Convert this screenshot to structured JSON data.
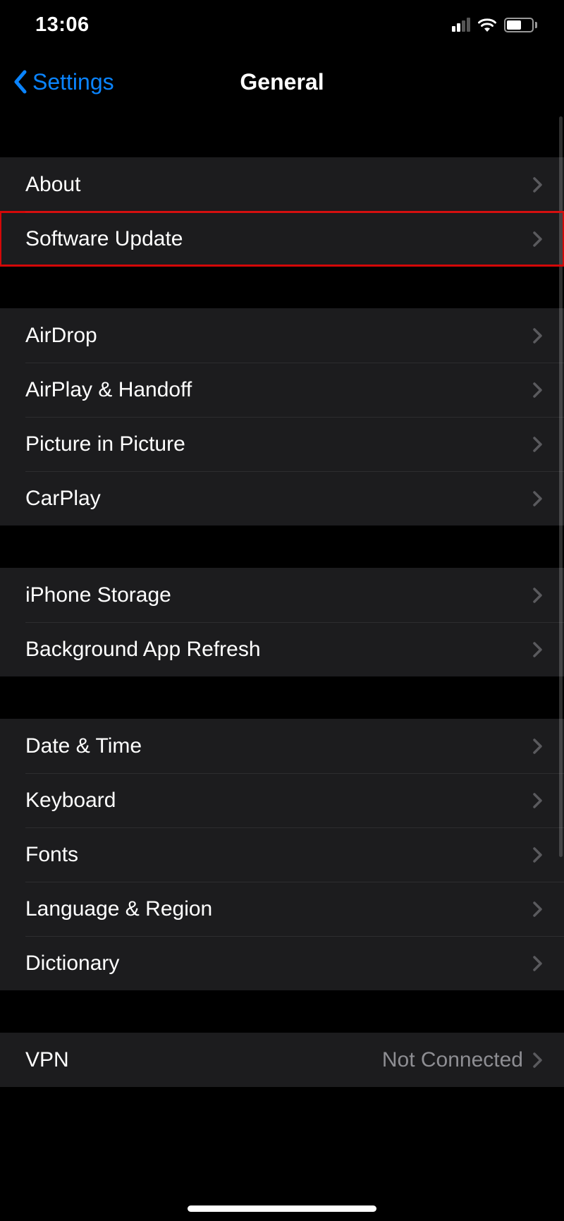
{
  "status_bar": {
    "time": "13:06"
  },
  "nav": {
    "back_label": "Settings",
    "title": "General"
  },
  "groups": [
    {
      "items": [
        {
          "id": "about",
          "label": "About",
          "detail": "",
          "highlight": false
        },
        {
          "id": "software-update",
          "label": "Software Update",
          "detail": "",
          "highlight": true
        }
      ]
    },
    {
      "items": [
        {
          "id": "airdrop",
          "label": "AirDrop",
          "detail": "",
          "highlight": false
        },
        {
          "id": "airplay-handoff",
          "label": "AirPlay & Handoff",
          "detail": "",
          "highlight": false
        },
        {
          "id": "picture-in-picture",
          "label": "Picture in Picture",
          "detail": "",
          "highlight": false
        },
        {
          "id": "carplay",
          "label": "CarPlay",
          "detail": "",
          "highlight": false
        }
      ]
    },
    {
      "items": [
        {
          "id": "iphone-storage",
          "label": "iPhone Storage",
          "detail": "",
          "highlight": false
        },
        {
          "id": "background-app-refresh",
          "label": "Background App Refresh",
          "detail": "",
          "highlight": false
        }
      ]
    },
    {
      "items": [
        {
          "id": "date-time",
          "label": "Date & Time",
          "detail": "",
          "highlight": false
        },
        {
          "id": "keyboard",
          "label": "Keyboard",
          "detail": "",
          "highlight": false
        },
        {
          "id": "fonts",
          "label": "Fonts",
          "detail": "",
          "highlight": false
        },
        {
          "id": "language-region",
          "label": "Language & Region",
          "detail": "",
          "highlight": false
        },
        {
          "id": "dictionary",
          "label": "Dictionary",
          "detail": "",
          "highlight": false
        }
      ]
    },
    {
      "items": [
        {
          "id": "vpn",
          "label": "VPN",
          "detail": "Not Connected",
          "highlight": false
        }
      ]
    }
  ]
}
